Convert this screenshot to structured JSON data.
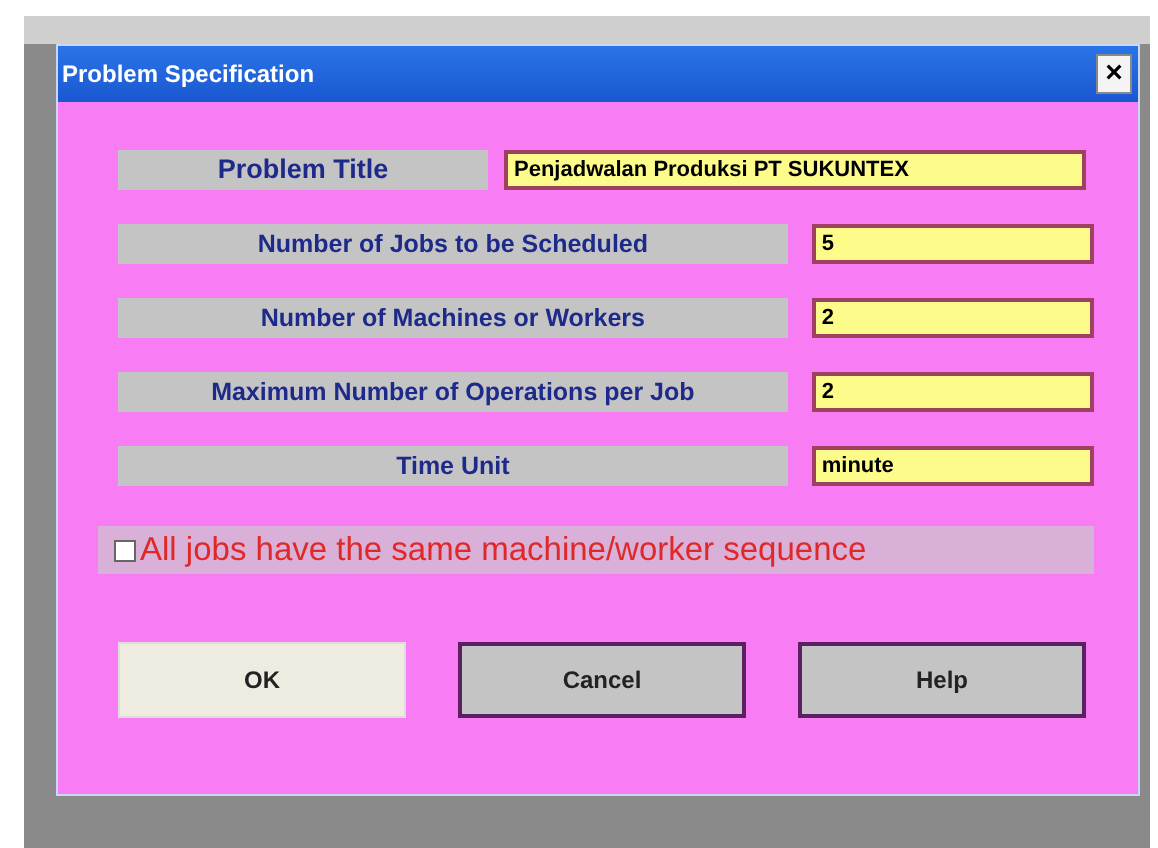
{
  "window": {
    "title": "Problem Specification",
    "close": "×"
  },
  "fields": [
    {
      "label": "Problem Title",
      "value": "Penjadwalan Produksi PT SUKUNTEX",
      "kind": "wide"
    },
    {
      "label": "Number of Jobs to be Scheduled",
      "value": "5",
      "kind": "short"
    },
    {
      "label": "Number of Machines or Workers",
      "value": "2",
      "kind": "short"
    },
    {
      "label": "Maximum Number of Operations per Job",
      "value": "2",
      "kind": "short"
    },
    {
      "label": "Time Unit",
      "value": "minute",
      "kind": "short"
    }
  ],
  "option": {
    "label": "All jobs have the same machine/worker sequence",
    "checked": false
  },
  "buttons": [
    {
      "label": "OK",
      "focused": true
    },
    {
      "label": "Cancel",
      "focused": false
    },
    {
      "label": "Help",
      "focused": false
    }
  ]
}
